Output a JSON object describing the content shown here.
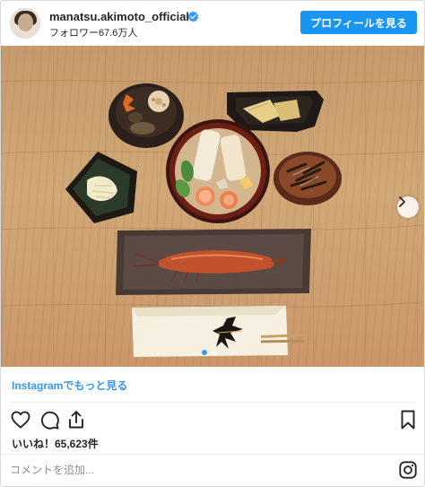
{
  "header": {
    "username": "manatsu.akimoto_official",
    "followers": "フォロワー67.6万人",
    "profile_button": "プロフィールを見る",
    "verified_icon": "verified-badge-icon",
    "avatar_icon": "profile-avatar"
  },
  "photo": {
    "alt_subject": "Japanese meal on wooden table",
    "next_arrow_icon": "chevron-right-icon",
    "carousel": {
      "count": 2,
      "active_index": 0
    }
  },
  "more_link": "Instagramでもっと見る",
  "actions": {
    "like_icon": "heart-icon",
    "comment_icon": "comment-icon",
    "share_icon": "share-icon",
    "save_icon": "bookmark-icon"
  },
  "likes": "いいね！65,623件",
  "comment": {
    "placeholder": "コメントを追加..."
  },
  "footer": {
    "instagram_icon": "instagram-icon"
  },
  "colors": {
    "accent": "#3897f0",
    "button": "#1a95f2",
    "text": "#262626",
    "muted": "#8e8e8e"
  }
}
